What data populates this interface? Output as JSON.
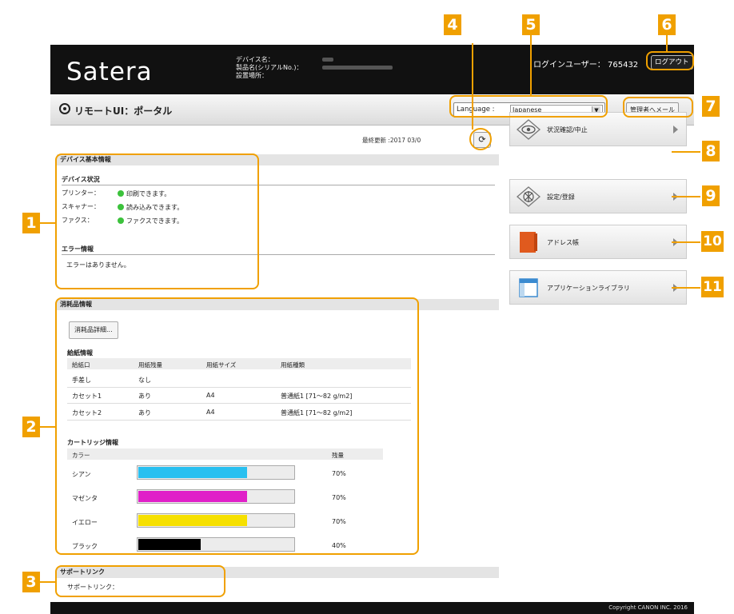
{
  "header": {
    "logo": "Satera",
    "device_name_label": "デバイス名：",
    "product_name_label": "製品名(シリアルNo.)：",
    "location_label": "設置場所：",
    "login_user_label": "ログインユーザー：",
    "login_user_value": "765432",
    "logout_label": "ログアウト"
  },
  "subbar": {
    "title": "リモートUI：ポータル",
    "language_label": "Language :",
    "language_value": "Japanese",
    "mail_label": "管理者へメール"
  },
  "main": {
    "last_updated": "最終更新 :2017 03/0",
    "refresh_icon": "refresh-icon",
    "device_info": {
      "title": "デバイス基本情報",
      "status_heading": "デバイス状況",
      "rows": [
        {
          "label": "プリンター：",
          "status": "印刷できます。"
        },
        {
          "label": "スキャナー：",
          "status": "読み込みできます。"
        },
        {
          "label": "ファクス：",
          "status": "ファクスできます。"
        }
      ],
      "status_color": "#3cc23c",
      "error_heading": "エラー情報",
      "error_text": "エラーはありません。"
    },
    "consumables": {
      "title": "消耗品情報",
      "details_button": "消耗品詳細...",
      "paper_heading": "給紙情報",
      "paper_columns": [
        "給紙口",
        "用紙残量",
        "用紙サイズ",
        "用紙種類"
      ],
      "paper_rows": [
        [
          "手差し",
          "なし",
          "",
          ""
        ],
        [
          "カセット1",
          "あり",
          "A4",
          "普通紙1 [71～82 g/m2]"
        ],
        [
          "カセット2",
          "あり",
          "A4",
          "普通紙1 [71～82 g/m2]"
        ]
      ],
      "cartridge_heading": "カートリッジ情報",
      "cartridge_columns": [
        "カラー",
        "残量"
      ],
      "cartridges": [
        {
          "name": "シアン",
          "level": 70,
          "level_text": "70%",
          "color": "#29c0f0"
        },
        {
          "name": "マゼンタ",
          "level": 70,
          "level_text": "70%",
          "color": "#e020c8"
        },
        {
          "name": "イエロー",
          "level": 70,
          "level_text": "70%",
          "color": "#f6e000"
        },
        {
          "name": "ブラック",
          "level": 40,
          "level_text": "40%",
          "color": "#000000"
        }
      ]
    },
    "support": {
      "title": "サポートリンク",
      "link_label": "サポートリンク："
    }
  },
  "nav": [
    {
      "label": "状況確認/中止",
      "icon": "eye-icon"
    },
    {
      "label": "設定/登録",
      "icon": "settings-icon"
    },
    {
      "label": "アドレス帳",
      "icon": "address-book-icon"
    },
    {
      "label": "アプリケーションライブラリ",
      "icon": "application-library-icon"
    }
  ],
  "footer": {
    "copyright": "Copyright CANON INC. 2016"
  },
  "callouts": [
    "1",
    "2",
    "3",
    "4",
    "5",
    "6",
    "7",
    "8",
    "9",
    "10",
    "11"
  ],
  "colors": {
    "callout": "#f0a000",
    "header": "#111111",
    "status_ok": "#3cc23c"
  }
}
